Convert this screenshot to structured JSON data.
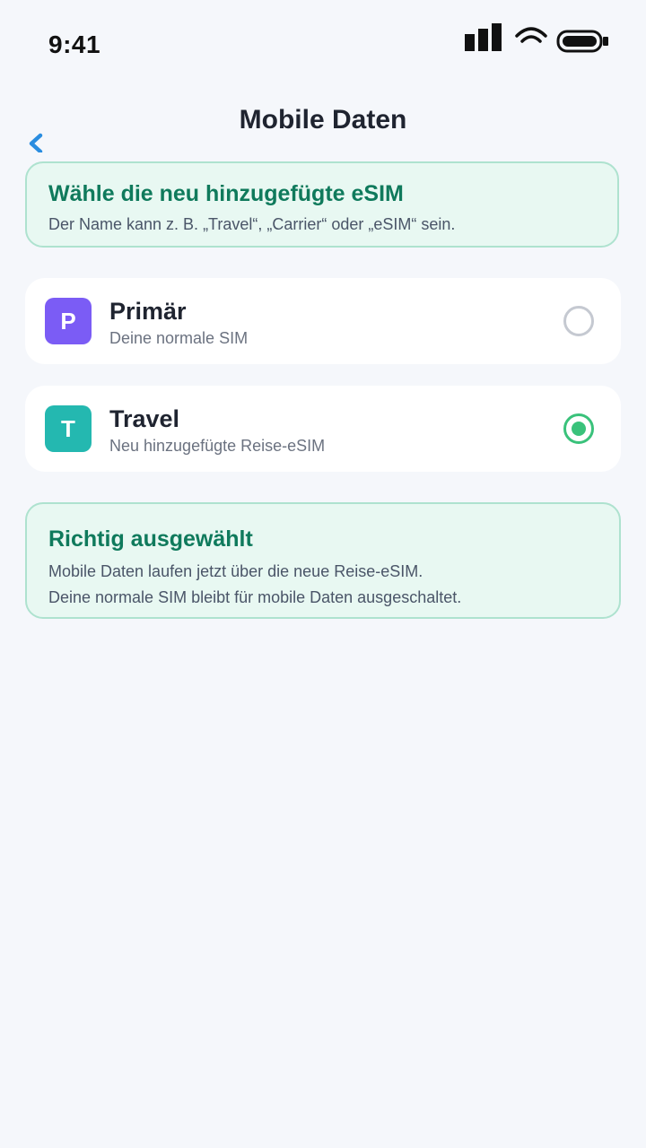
{
  "status_bar": {
    "time": "9:41",
    "icons": [
      "signal-icon",
      "wifi-icon",
      "battery-icon"
    ]
  },
  "nav": {
    "back_icon": "chevron-left-icon",
    "back_glyph": "‹",
    "title": "Mobile Daten"
  },
  "info_banner": {
    "title": "Wähle die neu hinzugefügte eSIM",
    "subtitle": "Der Name kann z. B. „Travel“, „Carrier“ oder „eSIM“ sein."
  },
  "sims": [
    {
      "initial": "P",
      "name": "Primär",
      "description": "Deine normale SIM",
      "selected": false,
      "color": "#7b5cf5"
    },
    {
      "initial": "T",
      "name": "Travel",
      "description": "Neu hinzugefügte Reise-eSIM",
      "selected": true,
      "color": "#24b8b0"
    }
  ],
  "result_banner": {
    "title": "Richtig ausgewählt",
    "line1": "Mobile Daten laufen jetzt über die neue Reise-eSIM.",
    "line2": "Deine normale SIM bleibt für mobile Daten ausgeschaltet."
  },
  "colors": {
    "accent_green": "#3ac27b",
    "banner_title": "#0f7a5c",
    "back_blue": "#2a8de0"
  }
}
